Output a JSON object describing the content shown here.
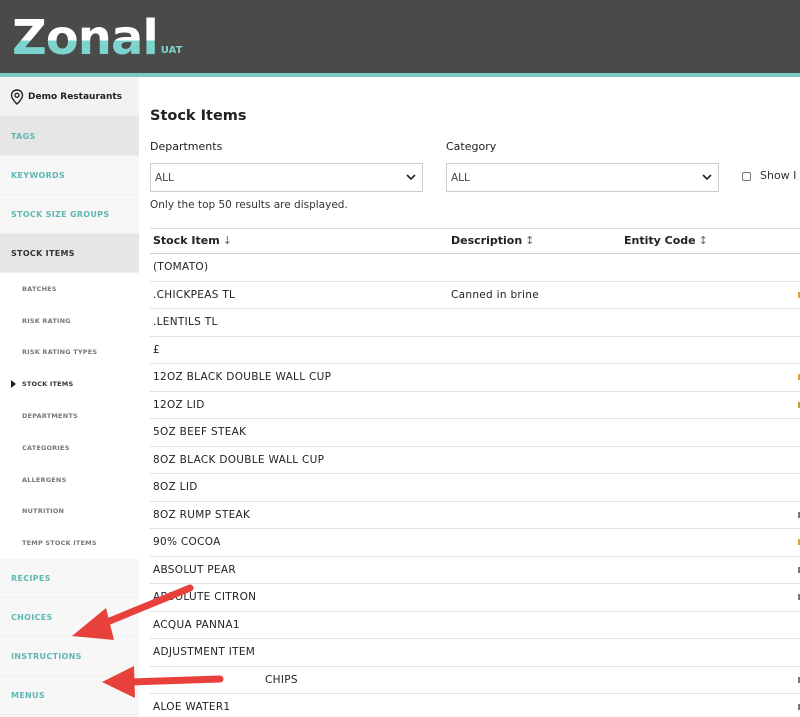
{
  "header": {
    "logo_text": "Zonal",
    "logo_sub": "UAT",
    "accent_color": "#7cc8c4"
  },
  "sidebar": {
    "organisation": "Demo Restaurants",
    "items": [
      {
        "label": "TAGS"
      },
      {
        "label": "KEYWORDS"
      },
      {
        "label": "STOCK SIZE GROUPS"
      },
      {
        "label": "STOCK ITEMS"
      }
    ],
    "sub_items": [
      {
        "label": "BATCHES"
      },
      {
        "label": "RISK RATING"
      },
      {
        "label": "RISK RATING TYPES"
      },
      {
        "label": "STOCK ITEMS"
      },
      {
        "label": "DEPARTMENTS"
      },
      {
        "label": "CATEGORIES"
      },
      {
        "label": "ALLERGENS"
      },
      {
        "label": "NUTRITION"
      },
      {
        "label": "TEMP STOCK ITEMS"
      }
    ],
    "bottom_items": [
      {
        "label": "RECIPES"
      },
      {
        "label": "CHOICES"
      },
      {
        "label": "INSTRUCTIONS"
      },
      {
        "label": "MENUS"
      }
    ]
  },
  "main": {
    "title": "Stock Items",
    "departments_label": "Departments",
    "departments_value": "ALL",
    "category_label": "Category",
    "category_value": "ALL",
    "show_label": "Show I",
    "note": "Only the top 50 results are displayed.",
    "columns": {
      "stock_item": "Stock Item",
      "stock_item_sort": "↓",
      "description": "Description",
      "description_sort": "↕",
      "entity_code": "Entity Code",
      "entity_code_sort": "↕"
    },
    "rows": [
      {
        "name": "(TOMATO)",
        "description": ""
      },
      {
        "name": ".CHICKPEAS TL",
        "description": "Canned in brine"
      },
      {
        "name": ".LENTILS TL",
        "description": ""
      },
      {
        "name": "£",
        "description": ""
      },
      {
        "name": "12OZ BLACK DOUBLE WALL CUP",
        "description": ""
      },
      {
        "name": "12OZ LID",
        "description": ""
      },
      {
        "name": "5OZ BEEF STEAK",
        "description": ""
      },
      {
        "name": "8OZ BLACK DOUBLE WALL CUP",
        "description": ""
      },
      {
        "name": "8OZ LID",
        "description": ""
      },
      {
        "name": "8OZ RUMP STEAK",
        "description": ""
      },
      {
        "name": "90% COCOA",
        "description": ""
      },
      {
        "name": "ABSOLUT PEAR",
        "description": ""
      },
      {
        "name": "ABSOLUTE CITRON",
        "description": ""
      },
      {
        "name": "ACQUA PANNA1",
        "description": ""
      },
      {
        "name": "ADJUSTMENT ITEM",
        "description": ""
      },
      {
        "name": "CHIPS",
        "description": ""
      },
      {
        "name": "ALOE WATER1",
        "description": ""
      }
    ]
  },
  "annotation_color": "#e8413b"
}
